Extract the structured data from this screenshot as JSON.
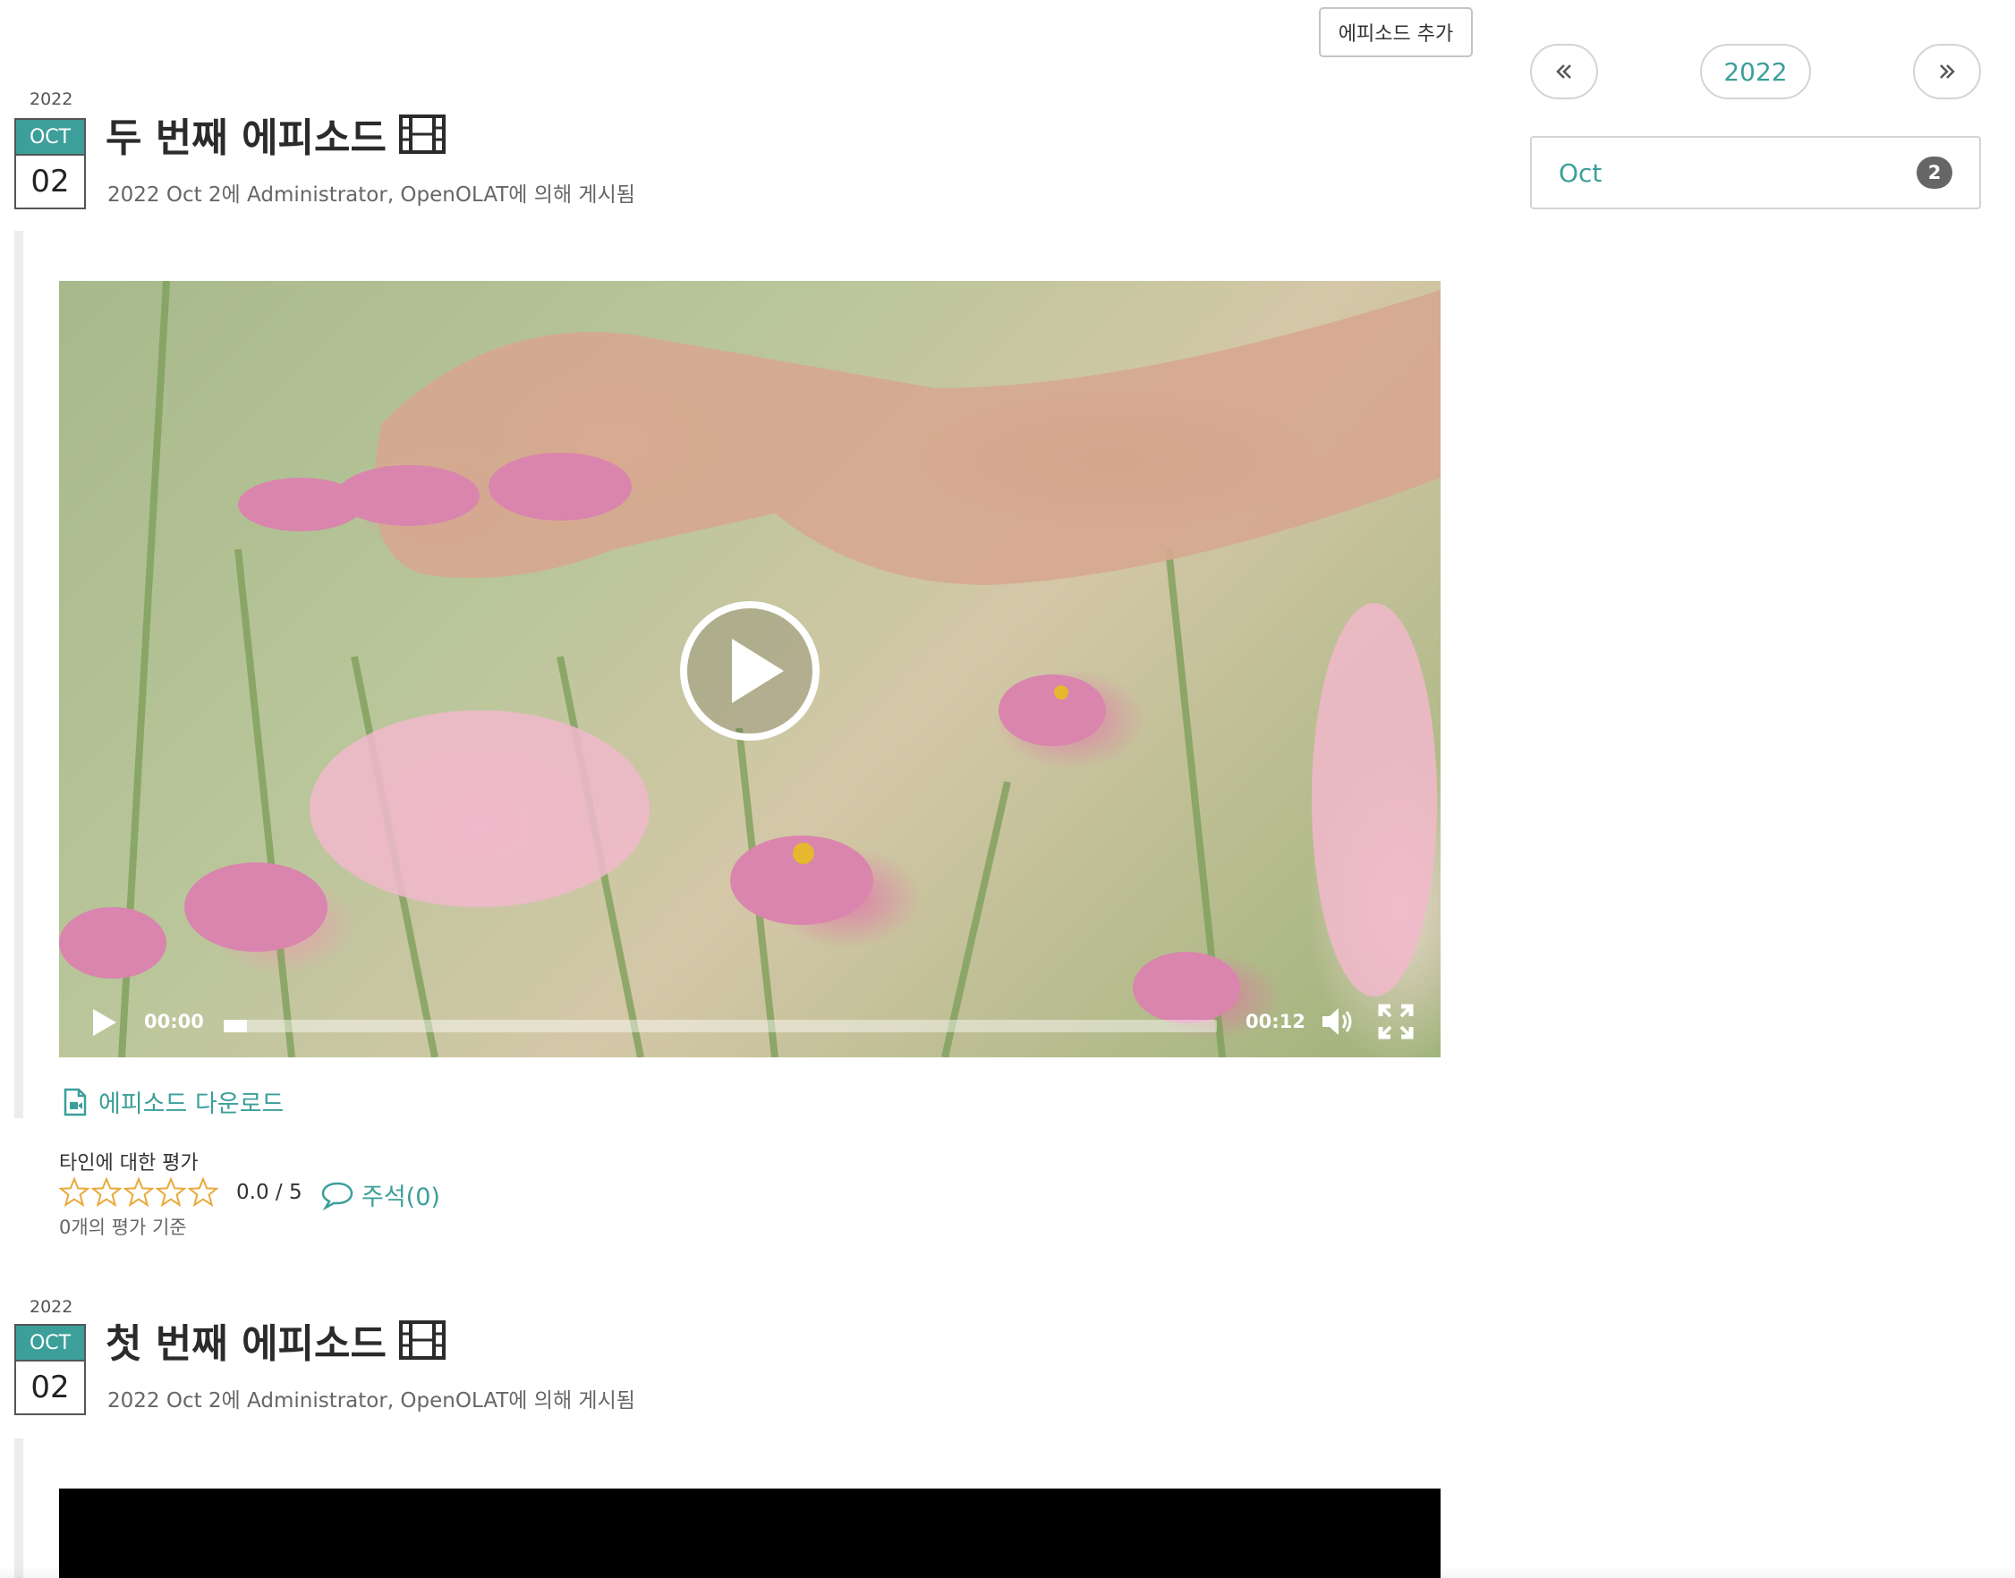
{
  "toolbar": {
    "add_episode_label": "에피소드 추가"
  },
  "sidebar": {
    "prev_icon": "double-chevron-left-icon",
    "next_icon": "double-chevron-right-icon",
    "year_label": "2022",
    "months": [
      {
        "label": "Oct",
        "count": "2"
      }
    ]
  },
  "posts": [
    {
      "year": "2022",
      "month": "OCT",
      "day": "02",
      "title": "두 번째 에피소드",
      "title_icon": "film-icon",
      "meta": "2022 Oct 2에 Administrator, OpenOLAT에 의해 게시됨",
      "video": {
        "current_time": "00:00",
        "duration": "00:12",
        "progress": 0.0
      },
      "download_label": "에피소드 다운로드",
      "rating": {
        "label": "타인에 대한 평가",
        "stars_filled": 0,
        "stars_total": 5,
        "value_text": "0.0 / 5",
        "count_text": "0개의 평가 기준"
      },
      "comments_label": "주석(0)"
    },
    {
      "year": "2022",
      "month": "OCT",
      "day": "02",
      "title": "첫 번째 에피소드",
      "title_icon": "film-icon",
      "meta": "2022 Oct 2에 Administrator, OpenOLAT에 의해 게시됨"
    }
  ],
  "colors": {
    "accent": "#3c9f9a",
    "star": "#e8a93a",
    "badge": "#666666"
  }
}
